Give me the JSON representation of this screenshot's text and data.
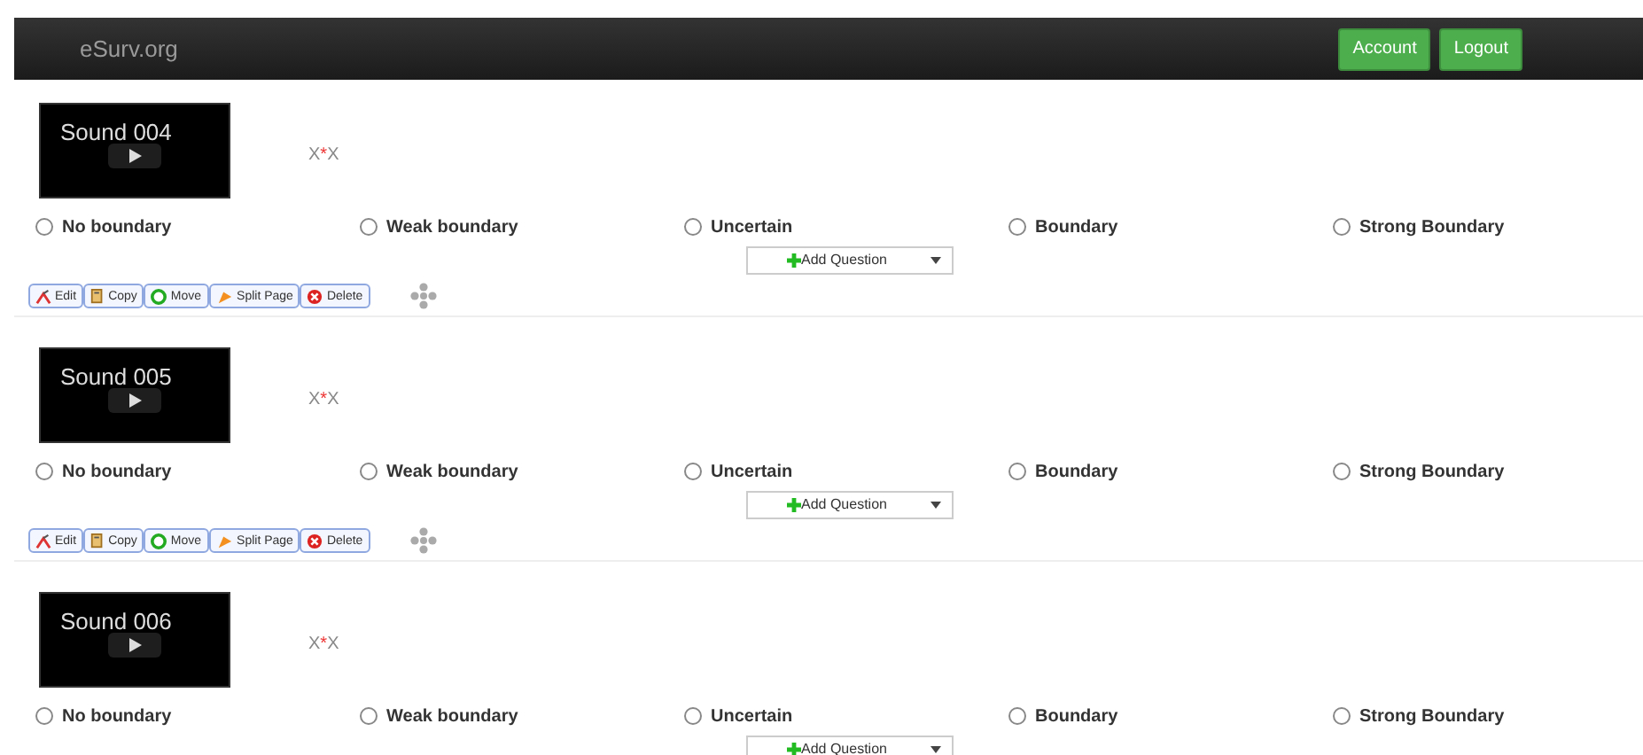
{
  "navbar": {
    "brand": "eSurv.org",
    "buttons": [
      "Account",
      "Logout"
    ]
  },
  "questions": [
    {
      "media_title": "Sound 004",
      "label_before": "X",
      "required_mark": "*",
      "label_after": "X",
      "options": [
        {
          "label": "No boundary",
          "selected": false
        },
        {
          "label": "Weak boundary",
          "selected": false
        },
        {
          "label": "Uncertain",
          "selected": false
        },
        {
          "label": "Boundary",
          "selected": false
        },
        {
          "label": "Strong Boundary",
          "selected": false
        }
      ],
      "add_question": "Add Question",
      "toolbar": [
        {
          "kind": "edit",
          "label": "Edit"
        },
        {
          "kind": "copy",
          "label": "Copy"
        },
        {
          "kind": "move",
          "label": "Move"
        },
        {
          "kind": "split",
          "label": "Split Page"
        },
        {
          "kind": "delete",
          "label": "Delete"
        }
      ]
    },
    {
      "media_title": "Sound 005",
      "label_before": "X",
      "required_mark": "*",
      "label_after": "X",
      "options": [
        {
          "label": "No boundary",
          "selected": false
        },
        {
          "label": "Weak boundary",
          "selected": false
        },
        {
          "label": "Uncertain",
          "selected": false
        },
        {
          "label": "Boundary",
          "selected": false
        },
        {
          "label": "Strong Boundary",
          "selected": false
        }
      ],
      "add_question": "Add Question",
      "toolbar": [
        {
          "kind": "edit",
          "label": "Edit"
        },
        {
          "kind": "copy",
          "label": "Copy"
        },
        {
          "kind": "move",
          "label": "Move"
        },
        {
          "kind": "split",
          "label": "Split Page"
        },
        {
          "kind": "delete",
          "label": "Delete"
        }
      ]
    },
    {
      "media_title": "Sound 006",
      "label_before": "X",
      "required_mark": "*",
      "label_after": "X",
      "options": [
        {
          "label": "No boundary",
          "selected": false
        },
        {
          "label": "Weak boundary",
          "selected": false
        },
        {
          "label": "Uncertain",
          "selected": false
        },
        {
          "label": "Boundary",
          "selected": false
        },
        {
          "label": "Strong Boundary",
          "selected": false
        }
      ],
      "add_question": "Add Question"
    }
  ]
}
